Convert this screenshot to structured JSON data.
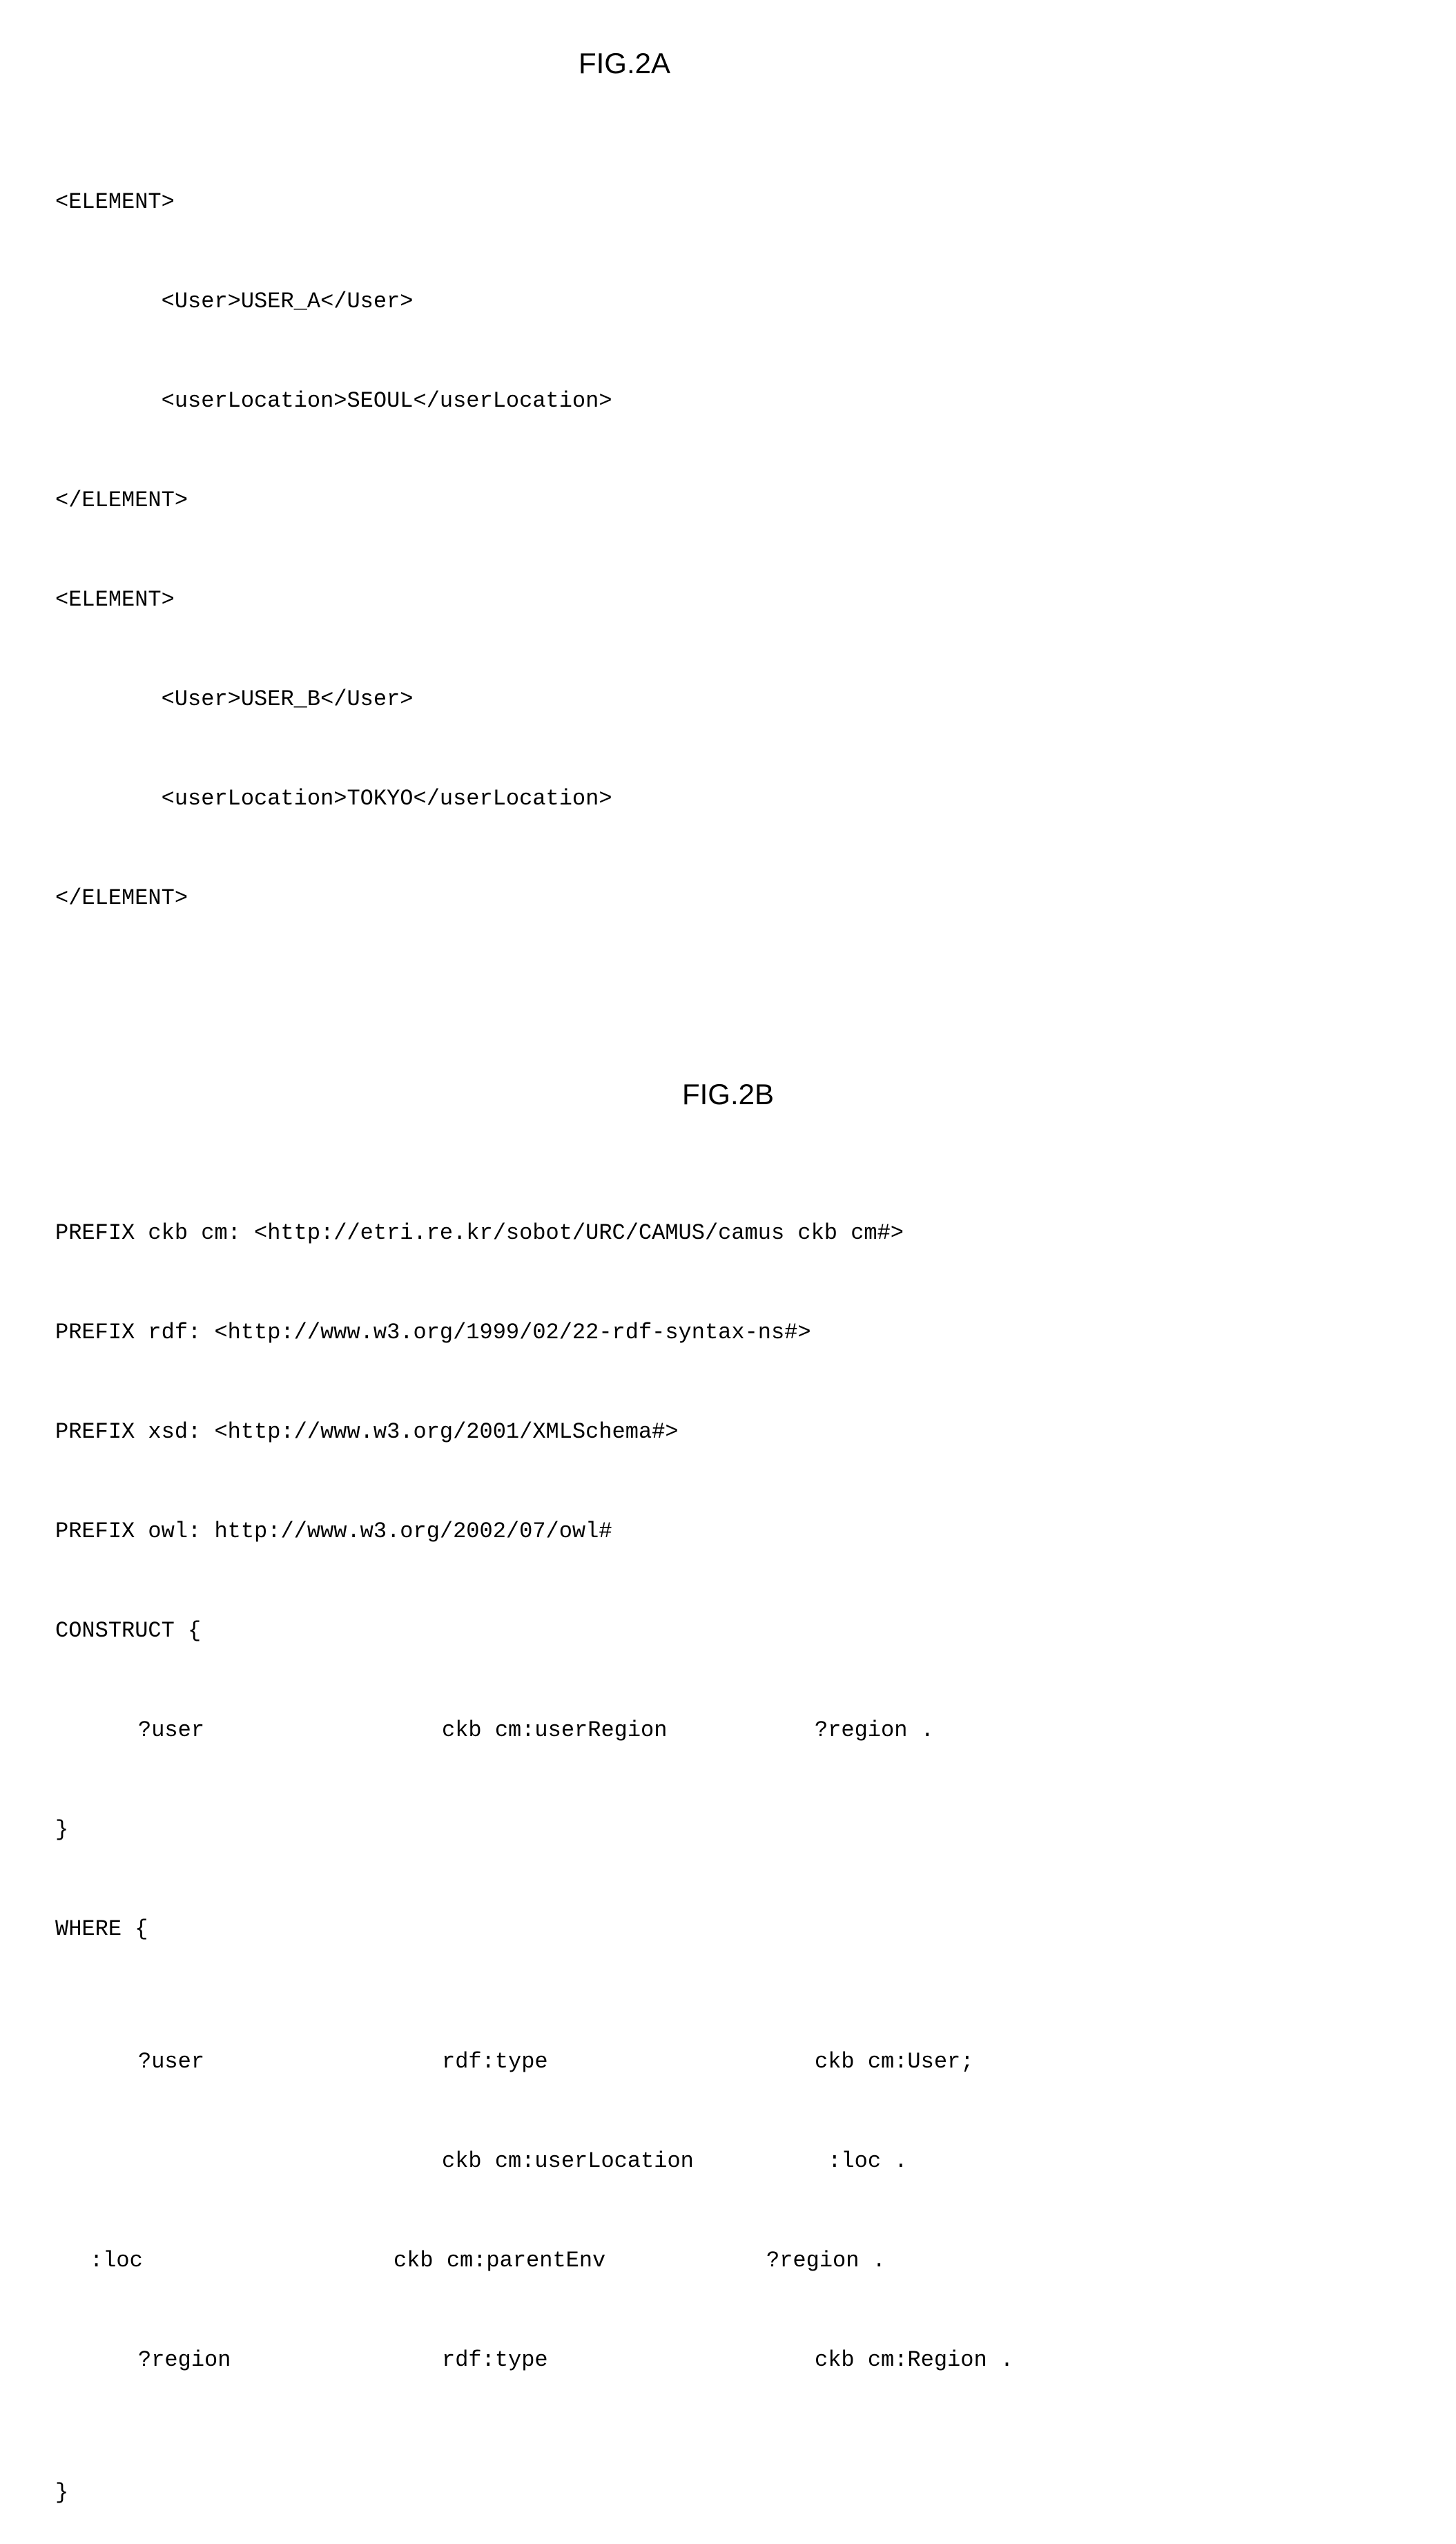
{
  "figA": {
    "title": "FIG.2A",
    "lines": [
      "<ELEMENT>",
      "        <User>USER_A</User>",
      "        <userLocation>SEOUL</userLocation>",
      "</ELEMENT>",
      "<ELEMENT>",
      "        <User>USER_B</User>",
      "        <userLocation>TOKYO</userLocation>",
      "</ELEMENT>"
    ]
  },
  "figB": {
    "title": "FIG.2B",
    "prefix": [
      "PREFIX ckb cm: <http://etri.re.kr/sobot/URC/CAMUS/camus ckb cm#>",
      "PREFIX rdf: <http://www.w3.org/1999/02/22-rdf-syntax-ns#>",
      "PREFIX xsd: <http://www.w3.org/2001/XMLSchema#>",
      "PREFIX owl: http://www.w3.org/2002/07/owl#"
    ],
    "construct_open": "CONSTRUCT {",
    "construct_row": {
      "c1": "?user",
      "c2": "ckb cm:userRegion",
      "c3": "?region ."
    },
    "construct_close": "}",
    "where_open": "WHERE {",
    "where_rows": [
      {
        "c1": "?user",
        "c2": "rdf:type",
        "c3": "ckb cm:User;",
        "pad": false
      },
      {
        "c1": "",
        "c2": "ckb cm:userLocation",
        "c3": " :loc .",
        "pad": false
      },
      {
        "c1": ":loc",
        "c2": "ckb cm:parentEnv",
        "c3": "?region .",
        "pad": true
      },
      {
        "c1": "?region",
        "c2": "rdf:type",
        "c3": "ckb cm:Region .",
        "pad": false
      }
    ],
    "where_close": "}"
  }
}
